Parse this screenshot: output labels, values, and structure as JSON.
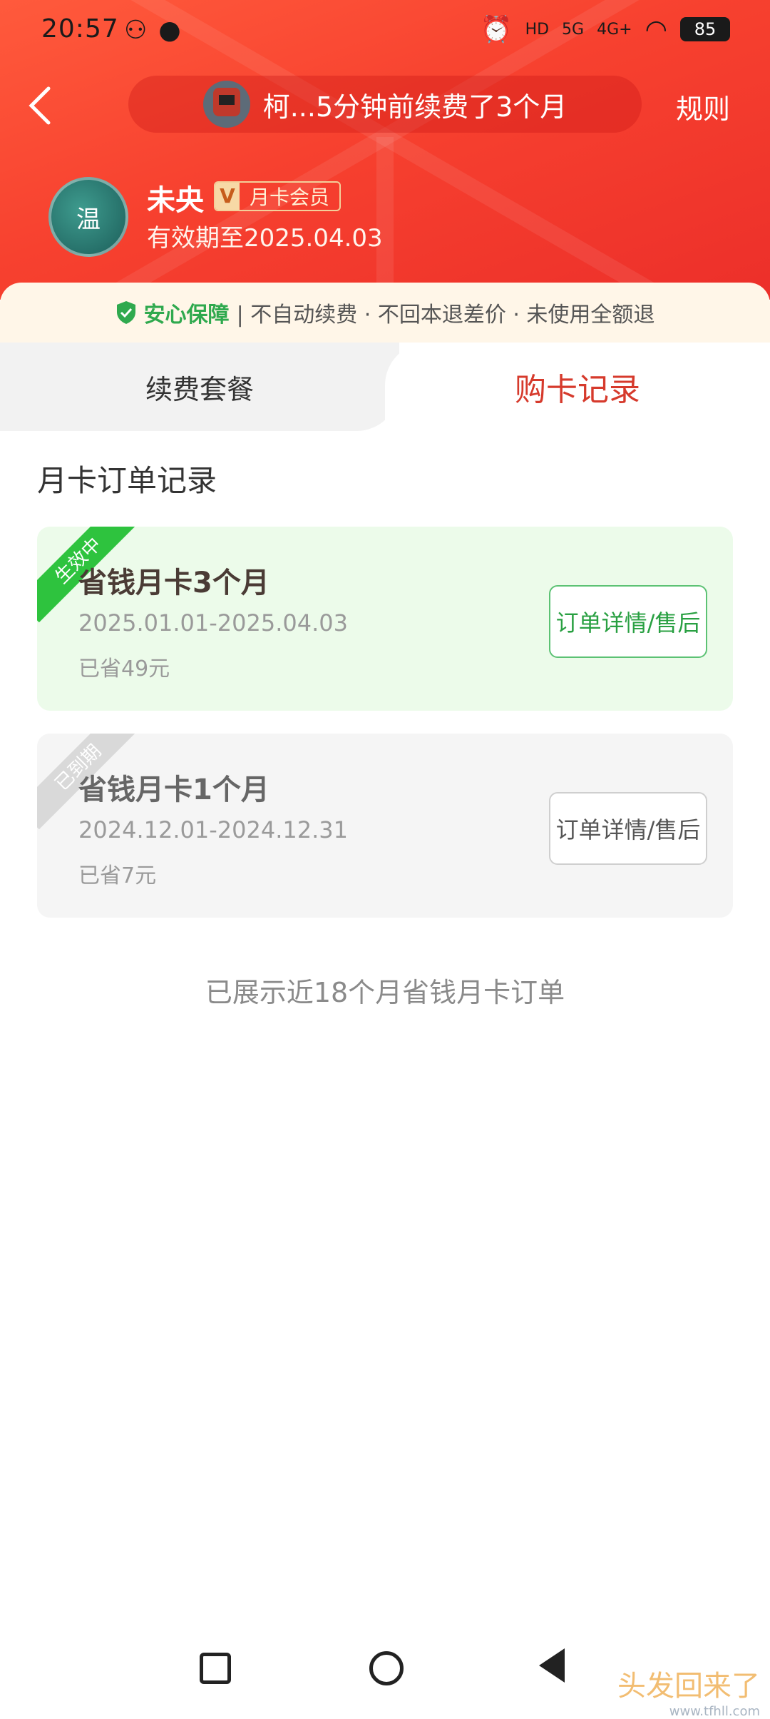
{
  "status_bar": {
    "time": "20:57",
    "battery": "85",
    "network_labels": [
      "HD",
      "5G",
      "4G+"
    ]
  },
  "nav": {
    "ticker_text": "柯...5分钟前续费了3个月",
    "rules_label": "规则"
  },
  "profile": {
    "name": "未央",
    "badge_v": "V",
    "badge_text": "月卡会员",
    "expire_text": "有效期至2025.04.03",
    "avatar_text": "温"
  },
  "guarantee": {
    "title": "安心保障",
    "text": "| 不自动续费 · 不回本退差价 · 未使用全额退"
  },
  "tabs": {
    "left": "续费套餐",
    "right": "购卡记录"
  },
  "section_title": "月卡订单记录",
  "orders": [
    {
      "status": "生效中",
      "title": "省钱月卡3个月",
      "dates": "2025.01.01-2025.04.03",
      "saved": "已省49元",
      "button": "订单详情/售后"
    },
    {
      "status": "已到期",
      "title": "省钱月卡1个月",
      "dates": "2024.12.01-2024.12.31",
      "saved": "已省7元",
      "button": "订单详情/售后"
    }
  ],
  "footer_note": "已展示近18个月省钱月卡订单",
  "watermark": {
    "text": "头发回来了",
    "sub": "www.tfhll.com"
  },
  "colors": {
    "hero_red": "#f7412f",
    "tab_active": "#d63a2c",
    "active_green": "#2ec33e",
    "guarantee_green": "#2fa94e"
  }
}
